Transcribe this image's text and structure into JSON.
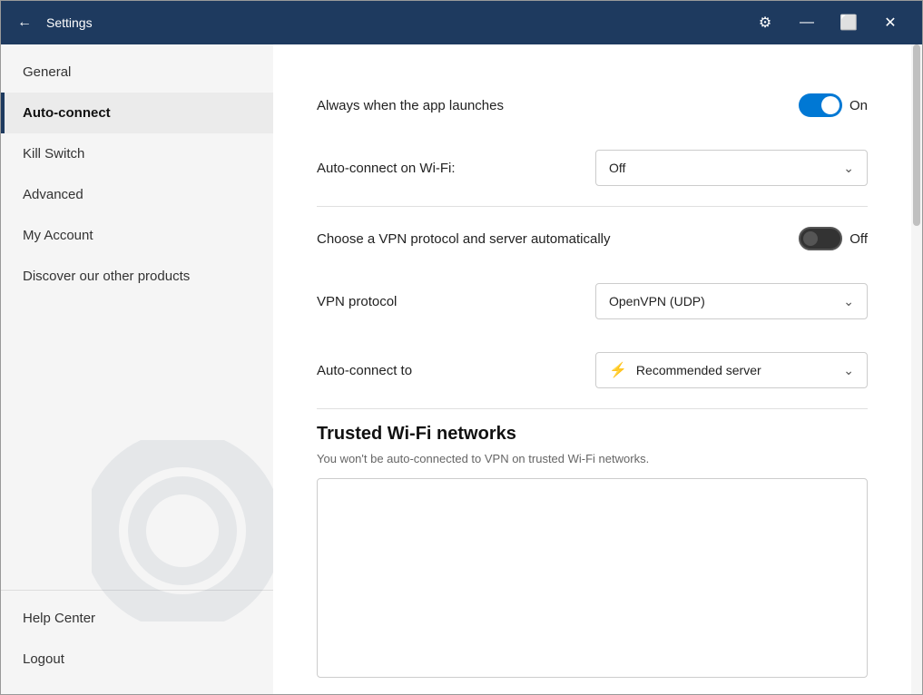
{
  "titleBar": {
    "title": "Settings",
    "backLabel": "←",
    "gearIconLabel": "⚙",
    "minimizeLabel": "—",
    "restoreLabel": "⬜",
    "closeLabel": "✕"
  },
  "sidebar": {
    "items": [
      {
        "id": "general",
        "label": "General",
        "active": false
      },
      {
        "id": "auto-connect",
        "label": "Auto-connect",
        "active": true
      },
      {
        "id": "kill-switch",
        "label": "Kill Switch",
        "active": false
      },
      {
        "id": "advanced",
        "label": "Advanced",
        "active": false
      },
      {
        "id": "my-account",
        "label": "My Account",
        "active": false
      },
      {
        "id": "discover",
        "label": "Discover our other products",
        "active": false
      }
    ],
    "bottomItems": [
      {
        "id": "help",
        "label": "Help Center"
      },
      {
        "id": "logout",
        "label": "Logout"
      }
    ]
  },
  "content": {
    "alwaysLaunch": {
      "label": "Always when the app launches",
      "toggleState": "on",
      "toggleLabel": "On"
    },
    "autoConnectWifi": {
      "label": "Auto-connect on Wi-Fi:",
      "dropdownValue": "Off"
    },
    "chooseVPN": {
      "label": "Choose a VPN protocol and server automatically",
      "toggleState": "off",
      "toggleLabel": "Off"
    },
    "vpnProtocol": {
      "label": "VPN protocol",
      "dropdownValue": "OpenVPN (UDP)"
    },
    "autoConnectTo": {
      "label": "Auto-connect to",
      "dropdownValue": "Recommended server",
      "dropdownIcon": "⚡"
    },
    "trustedNetworks": {
      "heading": "Trusted Wi-Fi networks",
      "subtext": "You won't be auto-connected to VPN on trusted Wi-Fi networks."
    }
  },
  "scrollbar": {
    "thumbTop": 0
  }
}
